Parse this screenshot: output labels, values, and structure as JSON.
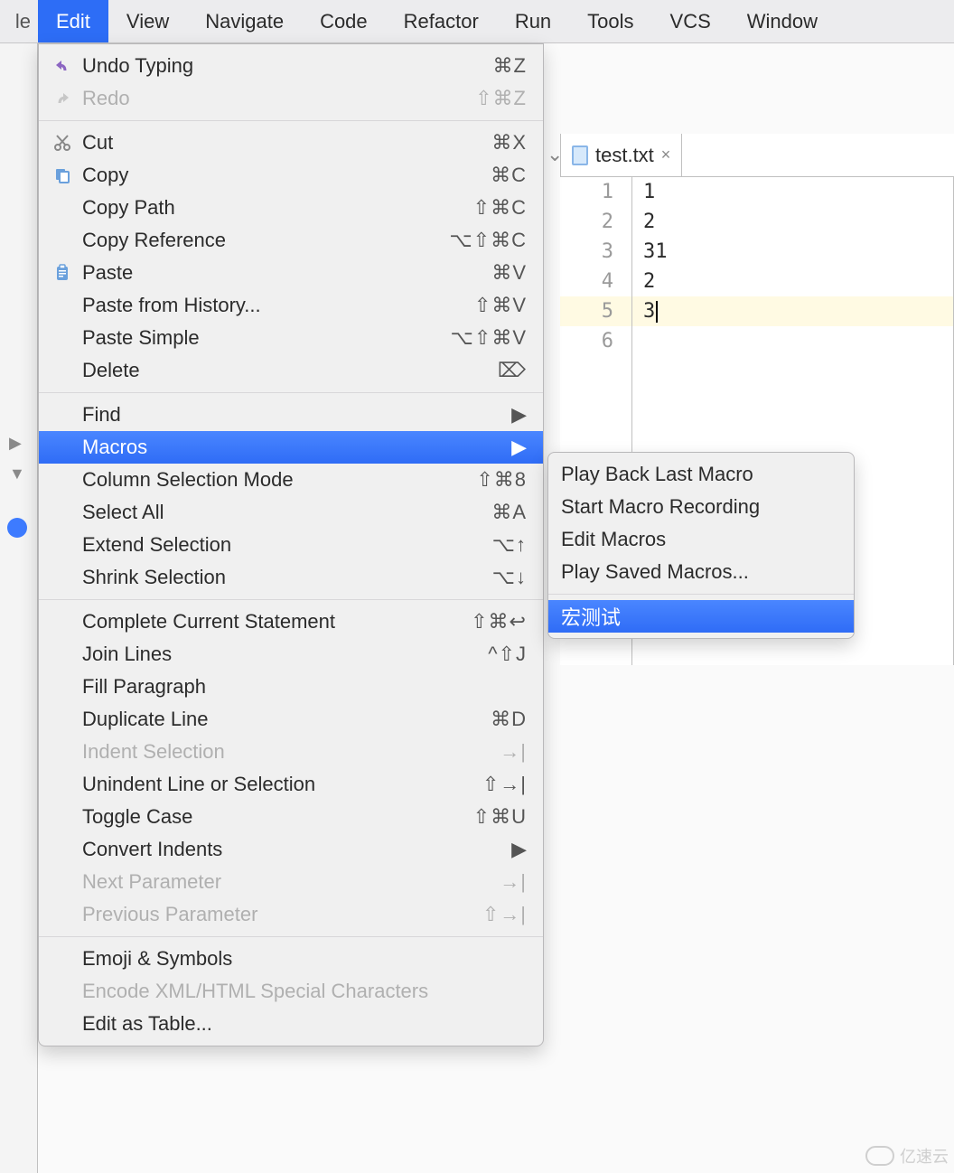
{
  "menubar": {
    "left_stub": "le",
    "items": [
      "Edit",
      "View",
      "Navigate",
      "Code",
      "Refactor",
      "Run",
      "Tools",
      "VCS",
      "Window"
    ],
    "open_index": 0
  },
  "toolbar_stub": {
    "preview": "",
    "actions": ""
  },
  "file_tab": {
    "name": "test.txt"
  },
  "editor": {
    "lines": [
      "1",
      "2",
      "31",
      "2",
      "3",
      ""
    ],
    "cursor_line_index": 4
  },
  "edit_menu": {
    "groups": [
      [
        {
          "label": "Undo Typing",
          "shortcut": "⌘Z",
          "icon": "undo-icon"
        },
        {
          "label": "Redo",
          "shortcut": "⇧⌘Z",
          "icon": "redo-icon",
          "disabled": true
        }
      ],
      [
        {
          "label": "Cut",
          "shortcut": "⌘X",
          "icon": "cut-icon"
        },
        {
          "label": "Copy",
          "shortcut": "⌘C",
          "icon": "copy-icon"
        },
        {
          "label": "Copy Path",
          "shortcut": "⇧⌘C"
        },
        {
          "label": "Copy Reference",
          "shortcut": "⌥⇧⌘C"
        },
        {
          "label": "Paste",
          "shortcut": "⌘V",
          "icon": "paste-icon"
        },
        {
          "label": "Paste from History...",
          "shortcut": "⇧⌘V"
        },
        {
          "label": "Paste Simple",
          "shortcut": "⌥⇧⌘V"
        },
        {
          "label": "Delete",
          "shortcut": "⌦"
        }
      ],
      [
        {
          "label": "Find",
          "submenu": true
        },
        {
          "label": "Macros",
          "submenu": true,
          "selected": true
        },
        {
          "label": "Column Selection Mode",
          "shortcut": "⇧⌘8"
        },
        {
          "label": "Select All",
          "shortcut": "⌘A"
        },
        {
          "label": "Extend Selection",
          "shortcut": "⌥↑"
        },
        {
          "label": "Shrink Selection",
          "shortcut": "⌥↓"
        }
      ],
      [
        {
          "label": "Complete Current Statement",
          "shortcut": "⇧⌘↩"
        },
        {
          "label": "Join Lines",
          "shortcut": "^⇧J"
        },
        {
          "label": "Fill Paragraph"
        },
        {
          "label": "Duplicate Line",
          "shortcut": "⌘D"
        },
        {
          "label": "Indent Selection",
          "shortcut": "→|",
          "disabled": true
        },
        {
          "label": "Unindent Line or Selection",
          "shortcut": "⇧→|"
        },
        {
          "label": "Toggle Case",
          "shortcut": "⇧⌘U"
        },
        {
          "label": "Convert Indents",
          "submenu": true
        },
        {
          "label": "Next Parameter",
          "shortcut": "→|",
          "disabled": true
        },
        {
          "label": "Previous Parameter",
          "shortcut": "⇧→|",
          "disabled": true
        }
      ],
      [
        {
          "label": "Emoji & Symbols"
        },
        {
          "label": "Encode XML/HTML Special Characters",
          "disabled": true
        },
        {
          "label": "Edit as Table..."
        }
      ]
    ]
  },
  "macros_submenu": {
    "groups": [
      [
        {
          "label": "Play Back Last Macro"
        },
        {
          "label": "Start Macro Recording"
        },
        {
          "label": "Edit Macros"
        },
        {
          "label": "Play Saved Macros..."
        }
      ],
      [
        {
          "label": "宏测试",
          "selected": true
        }
      ]
    ]
  },
  "watermark": {
    "text": "亿速云"
  }
}
